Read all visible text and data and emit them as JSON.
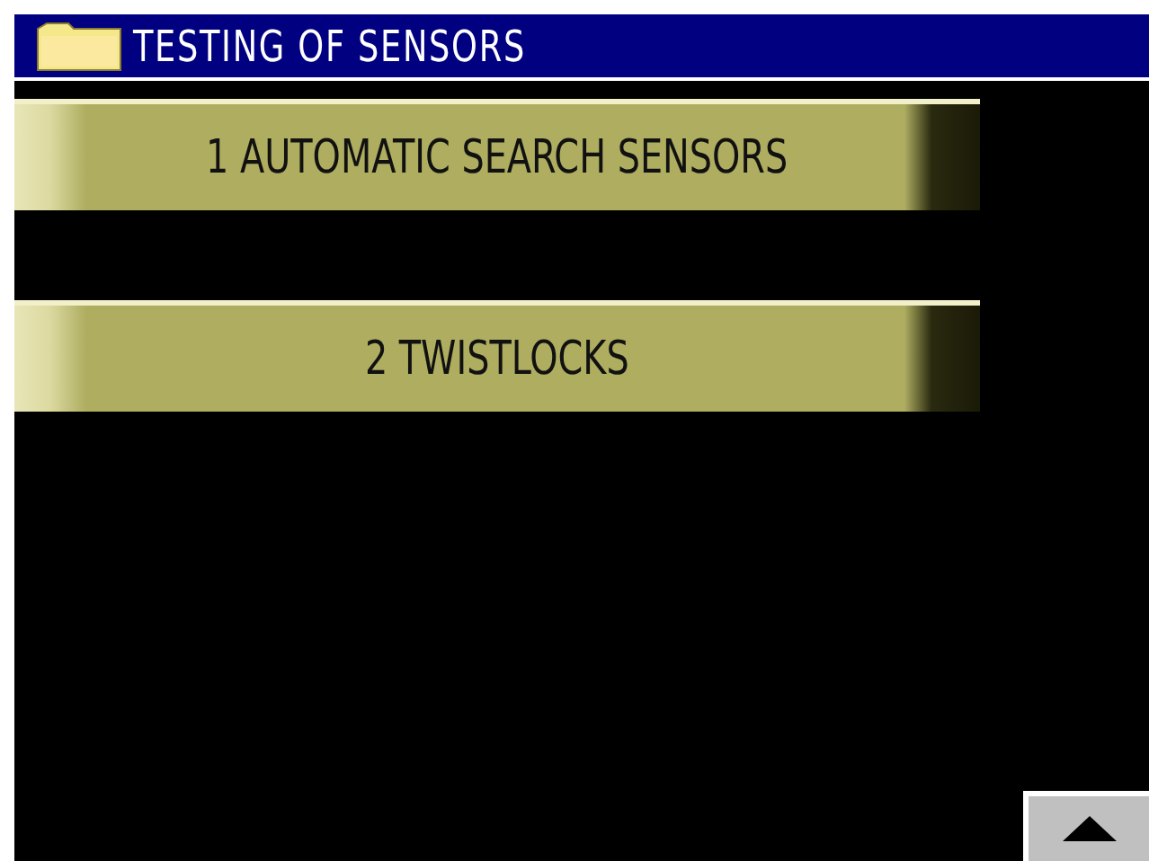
{
  "window": {
    "title": "TESTING OF SENSORS"
  },
  "menu": [
    {
      "label": "1 AUTOMATIC SEARCH SENSORS"
    },
    {
      "label": "2 TWISTLOCKS"
    }
  ]
}
